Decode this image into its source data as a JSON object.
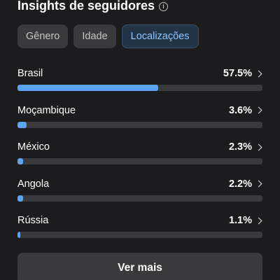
{
  "header": {
    "title": "Insights de seguidores"
  },
  "tabs": [
    {
      "label": "Gênero",
      "active": false
    },
    {
      "label": "Idade",
      "active": false
    },
    {
      "label": "Localizações",
      "active": true
    }
  ],
  "locations": [
    {
      "name": "Brasil",
      "percent_label": "57.5%",
      "value": 57.5
    },
    {
      "name": "Moçambique",
      "percent_label": "3.6%",
      "value": 3.6
    },
    {
      "name": "México",
      "percent_label": "2.3%",
      "value": 2.3
    },
    {
      "name": "Angola",
      "percent_label": "2.2%",
      "value": 2.2
    },
    {
      "name": "Rússia",
      "percent_label": "1.1%",
      "value": 1.1
    }
  ],
  "footer": {
    "more_label": "Ver mais"
  },
  "colors": {
    "accent": "#5ba4f4",
    "track": "#3a3a3c",
    "background": "#1c1c1e"
  }
}
